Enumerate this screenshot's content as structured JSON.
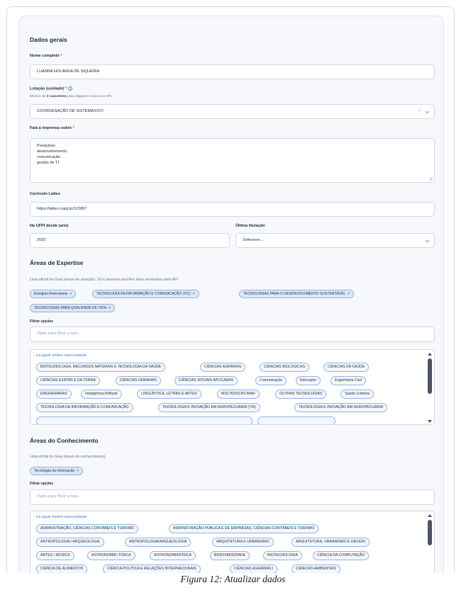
{
  "dados": {
    "title": "Dados gerais",
    "nome": {
      "label": "Nome completo",
      "required": "*",
      "value": "LUANNA HOLANDA DE SIQUEIRA"
    },
    "lotacao": {
      "label": "Lotação (unidade)",
      "required": "*",
      "info_icon": "info-icon",
      "hint_pre": "Mínimo de ",
      "hint_bold": "3 caracteres",
      "hint_post": " para disparar a busca na API.",
      "value": "COORDENAÇÃO DE SISTEMAS/STI",
      "clear": "×"
    },
    "fala": {
      "label": "Fala à imprensa sobre",
      "required": "*",
      "lines": [
        "Pesquisas",
        "desenvolvimento",
        "comunicação",
        "gestão de TI"
      ]
    },
    "lattes": {
      "label": "Currículo Lattes",
      "value": "https://lattes.cnpq.br/123897"
    },
    "ufpi": {
      "label": "Na UFPI desde (ano)",
      "value": "2020"
    },
    "titulacao": {
      "label": "Última titulação",
      "value": "Selecione..."
    }
  },
  "expertise": {
    "title": "Áreas de Expertise",
    "hint": "Lista oficial do Guia (áreas de atuação). Só é possível escolher itens retornados pela API.",
    "selected": [
      {
        "label": "Energias Renováveis",
        "x": "×"
      },
      {
        "label": "TECNOLOGIA DA INFORMAÇÃO E COMUNICAÇÃO (TIC)",
        "x": "×"
      },
      {
        "label": "TECNOLOGIAS PARA O DESENVOLVIMENTO SUSTENTÁVEL",
        "x": "×"
      },
      {
        "label": "TECNOLOGIAS PARA QUALIDADE DE VIDA",
        "x": "×"
      }
    ],
    "filter_label": "Filtrar opções",
    "filter_placeholder": "Digite para filtrar a lista...",
    "list_head": "CLIQUE PARA ADICIONAR",
    "options": [
      "BIOTECNOLOGIA, RECURSOS NATURAIS E TECNOLOGIA DA SAÚDE",
      "CIÊNCIAS AGRÁRIAS",
      "CIÊNCIAS BIOLÓGICAS",
      "CIÊNCIAS DA SAÚDE",
      "CIÊNCIAS EXATAS E DA TERRA",
      "CIÊNCIAS HUMANAS",
      "CIÊNCIAS SOCIAIS APLICADAS",
      "Comunicação",
      "Educação",
      "Engenharia Civil",
      "ENGENHARIAS",
      "Inteligência Artificial",
      "LINGUÍSTICA, LETRAS E ARTES",
      "MULTIDISCIPLINAR",
      "OUTRAS TECNOLOGIAS",
      "Saúde Coletiva",
      "TECNOLOGIA DA INFORMAÇÃO E COMUNICAÇÃO",
      "TECNOLOGIA E INOVAÇÃO EM AGROPECUÁRIA (TIA)",
      "TECNOLOGIA E INOVAÇÃO EM AGROPECUÁRIA"
    ]
  },
  "conhecimento": {
    "title": "Áreas do Conhecimento",
    "hint": "Lista oficial do Guia (áreas do conhecimento).",
    "selected": [
      {
        "label": "Tecnologia da Informação",
        "x": "×"
      }
    ],
    "filter_label": "Filtrar opções",
    "filter_placeholder": "Digite para filtrar a lista...",
    "list_head": "CLIQUE PARA ADICIONAR",
    "options": [
      "ADMINISTRAÇÃO, CIÊNCIAS CONTÁBEIS E TURISMO",
      "ADMINISTRAÇÃO PÚBLICA E DE EMPRESAS, CIÊNCIAS CONTÁBEIS E TURISMO",
      "ANTROPOLOGIA / ARQUEOLOGIA",
      "ANTROPOLOGIA/ARQUEOLOGIA",
      "ARQUITETURA E URBANISMO",
      "ARQUITETURA, URBANISMO E DESIGN",
      "ARTES / MÚSICA",
      "ASTRONOMIA / FÍSICA",
      "ASTRONOMIA/FÍSICA",
      "BIODIVERSIDADE",
      "BIOTECNOLOGIA",
      "CIÊNCIA DA COMPUTAÇÃO",
      "CIÊNCIA DE ALIMENTOS",
      "CIÊNCIA POLÍTICA E RELAÇÕES INTERNACIONAIS",
      "CIÊNCIAS AGRÁRIAS I",
      "CIÊNCIAS AMBIENTAIS"
    ]
  },
  "caption": "Figura 12: Atualizar dados",
  "colors": {
    "accent": "#3b82f6",
    "required": "#e11d48",
    "pill_border": "#8fb3e6",
    "pill_bg": "#dce8f8"
  }
}
